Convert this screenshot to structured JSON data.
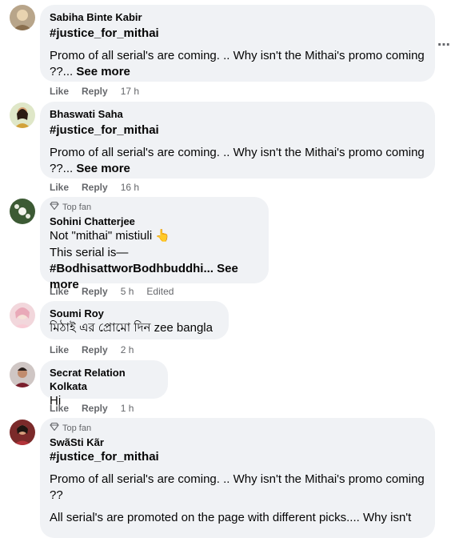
{
  "comments": [
    {
      "author": "Sabiha Binte Kabir",
      "hashtag": "#justice_for_mithai",
      "line1": "Promo of all serial's are coming. .. Why isn't the Mithai's promo coming",
      "line2": "??...",
      "see_more": "See more",
      "like": "Like",
      "reply": "Reply",
      "time": "17 h"
    },
    {
      "author": "Bhaswati Saha",
      "hashtag": "#justice_for_mithai",
      "line1": "Promo of all serial's are coming. .. Why isn't the Mithai's promo coming",
      "line2": "??...",
      "see_more": "See more",
      "like": "Like",
      "reply": "Reply",
      "time": "16 h"
    },
    {
      "badge": "Top fan",
      "author": "Sohini Chatterjee",
      "line1": "Not \"mithai\" mistiuli 👆",
      "line2": "This serial is—",
      "line3": "#BodhisattworBodhbuddhi...",
      "see_more": "See more",
      "like": "Like",
      "reply": "Reply",
      "time": "5 h",
      "edited": "Edited"
    },
    {
      "author": "Soumi Roy",
      "line1": "মিঠাই এর প্রোমো দিন zee bangla",
      "like": "Like",
      "reply": "Reply",
      "time": "2 h"
    },
    {
      "author": "Secrat Relation Kolkata",
      "line1": "Hi",
      "like": "Like",
      "reply": "Reply",
      "time": "1 h"
    },
    {
      "badge": "Top fan",
      "author": "SwãSti Kãr",
      "hashtag": "#justice_for_mithai",
      "line1": "Promo of all serial's are coming. .. Why isn't the Mithai's promo coming",
      "line2": "??",
      "line3": "All serial's are promoted on the page with different picks.... Why isn't"
    }
  ],
  "more_icon": "more-options-icon",
  "badge_icon": "diamond-icon",
  "colors": {
    "bubble": "#f0f2f5",
    "secondary_text": "#65676b",
    "primary_text": "#050505"
  }
}
